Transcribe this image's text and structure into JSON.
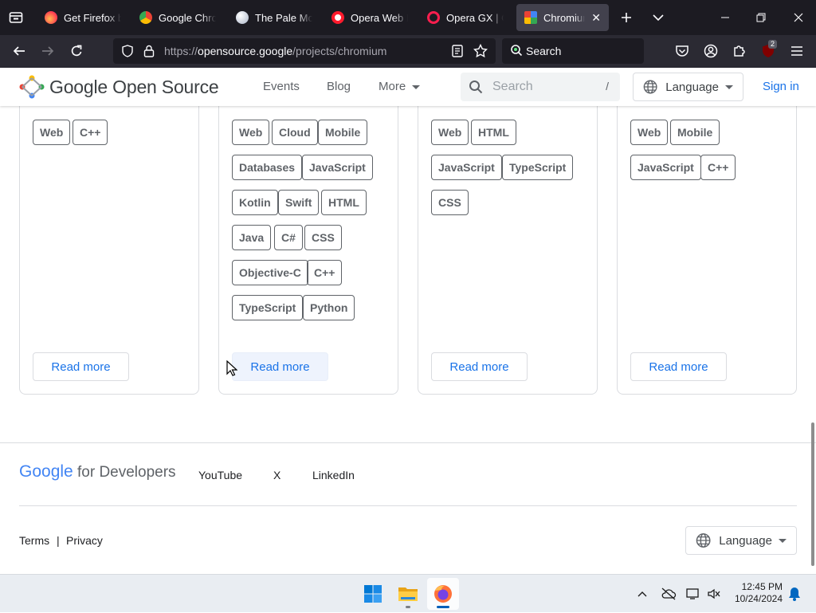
{
  "browser": {
    "tabs": [
      {
        "title": "Get Firefox browser",
        "active": false
      },
      {
        "title": "Google Chrome",
        "active": false
      },
      {
        "title": "The Pale Moon",
        "active": false
      },
      {
        "title": "Opera Web Browser",
        "active": false
      },
      {
        "title": "Opera GX | Gaming",
        "active": false
      },
      {
        "title": "Chromium",
        "active": true
      }
    ],
    "url_prefix": "https://",
    "url_host": "opensource.google",
    "url_path": "/projects/chromium",
    "search_placeholder": "Search",
    "extension_badge": "2"
  },
  "site": {
    "logo": "Google Open Source",
    "nav": [
      "Events",
      "Blog",
      "More"
    ],
    "search_placeholder": "Search",
    "search_shortcut": "/",
    "language_label": "Language",
    "signin_label": "Sign in"
  },
  "cards": [
    {
      "chips": [
        "Web",
        "C++"
      ],
      "cta": "Read more"
    },
    {
      "chips": [
        "Web",
        "Cloud",
        "Mobile",
        "Databases",
        "JavaScript",
        "Kotlin",
        "Swift",
        "HTML",
        "Java",
        "C#",
        "CSS",
        "Objective-C",
        "C++",
        "TypeScript",
        "Python"
      ],
      "cta": "Read more"
    },
    {
      "chips": [
        "Web",
        "HTML",
        "JavaScript",
        "TypeScript",
        "CSS"
      ],
      "cta": "Read more"
    },
    {
      "chips": [
        "Web",
        "Mobile",
        "JavaScript",
        "C++"
      ],
      "cta": "Read more"
    }
  ],
  "footer": {
    "brand_google": "Google",
    "brand_rest": "for Developers",
    "social": [
      "YouTube",
      "X",
      "LinkedIn"
    ],
    "terms": "Terms",
    "separator": "|",
    "privacy": "Privacy",
    "language_label": "Language"
  },
  "taskbar": {
    "time": "12:45 PM",
    "date": "10/24/2024"
  },
  "colors": {
    "link_blue": "#1a73e8",
    "chrome_dark": "#1c1b22"
  }
}
